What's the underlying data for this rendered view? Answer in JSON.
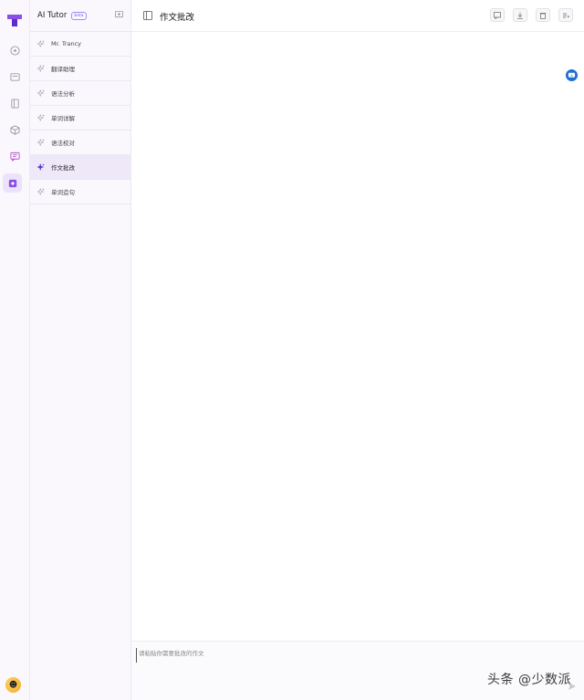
{
  "rail": {
    "icons": [
      "logo-icon",
      "compass-icon",
      "card-icon",
      "book-icon",
      "cube-icon",
      "chat-icon",
      "tutor-icon"
    ],
    "avatar_icon": "smiley-avatar"
  },
  "panel": {
    "title": "AI Tutor",
    "badge": "beta",
    "assistants": [
      {
        "label": "Mr. Trancy"
      },
      {
        "label": "翻译助理"
      },
      {
        "label": "语法分析"
      },
      {
        "label": "单词详解"
      },
      {
        "label": "语法校对"
      },
      {
        "label": "作文批改",
        "active": true
      },
      {
        "label": "单词造句"
      }
    ]
  },
  "main": {
    "title": "作文批改",
    "toolbar": [
      "feedback-icon",
      "download-icon",
      "trash-icon",
      "clear-icon"
    ],
    "input_placeholder": "请粘贴你需要批改的作文"
  },
  "watermark": "头条 @少数派",
  "colors": {
    "accent": "#7d5ce8",
    "active_bg": "#eee8f9",
    "bg_panel": "#faf8fd"
  }
}
